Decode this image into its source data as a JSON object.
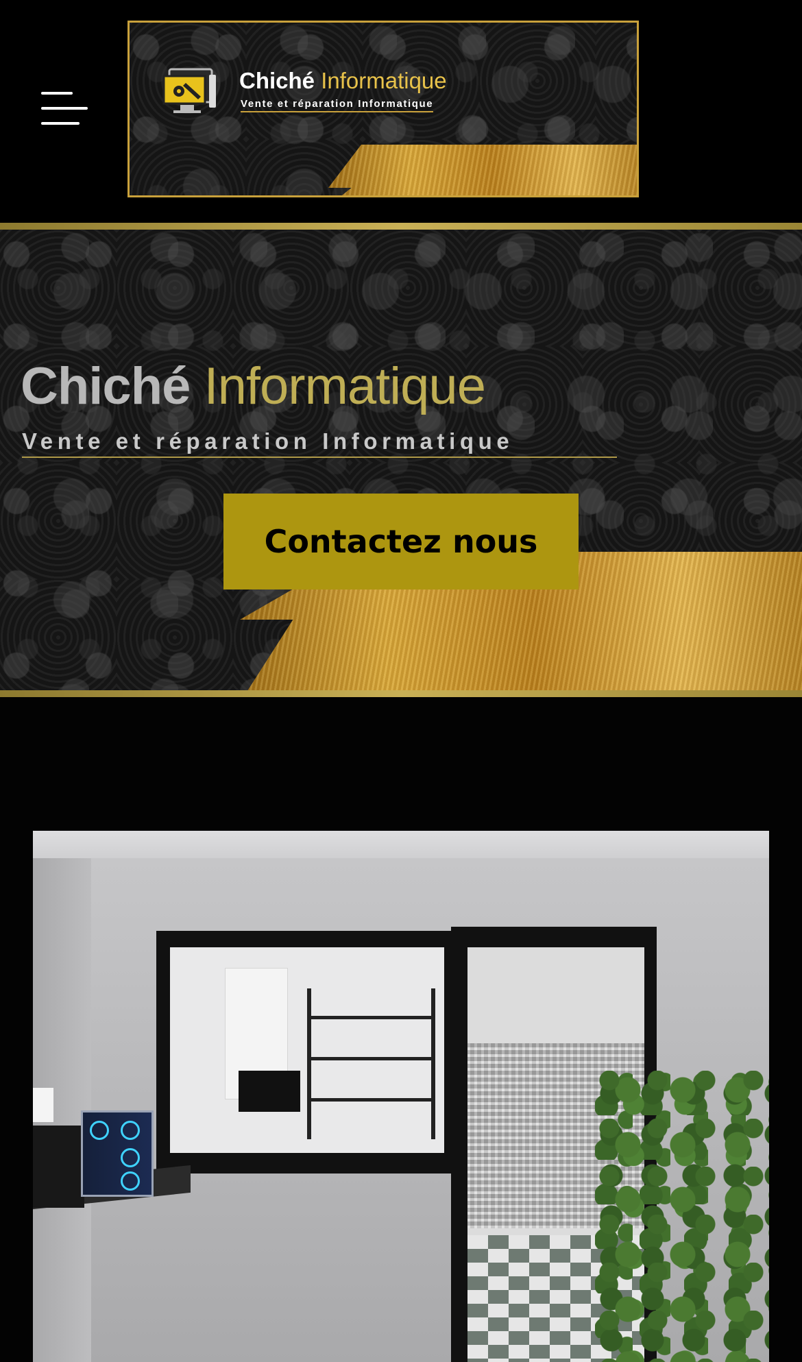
{
  "header": {
    "menu_icon": "hamburger-menu-icon",
    "logo": {
      "brand_main": "Chiché",
      "brand_accent": "Informatique",
      "tagline": "Vente et réparation Informatique",
      "icon": "computer-repair-icon"
    }
  },
  "hero": {
    "title_main": "Chiché",
    "title_accent": "Informatique",
    "subtitle": "Vente et réparation Informatique",
    "cta_label": "Contactez nous"
  },
  "colors": {
    "page_background": "#030303",
    "gold_accent": "#ad9610",
    "gold_border": "#c9a13b",
    "cta_text": "#000000"
  },
  "shop_photo": {
    "description_icon": "shop-interior-photo"
  }
}
